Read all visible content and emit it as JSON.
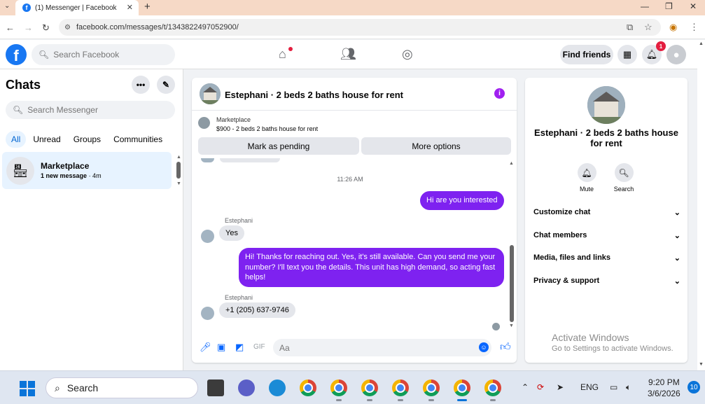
{
  "browser": {
    "tab_title": "(1) Messenger | Facebook",
    "url": "facebook.com/messages/t/1343822497052900/"
  },
  "header": {
    "search_placeholder": "Search Facebook",
    "find_friends_label": "Find friends",
    "notification_count": "1"
  },
  "sidebar": {
    "title": "Chats",
    "search_placeholder": "Search Messenger",
    "filters": [
      "All",
      "Unread",
      "Groups",
      "Communities"
    ],
    "active_filter": "All",
    "chat": {
      "name": "Marketplace",
      "unread_text": "1 new message",
      "time": "· 4m"
    }
  },
  "conversation": {
    "title": "Estephani · 2 beds 2 baths house for rent",
    "marketplace_label": "Marketplace",
    "listing": "$900 - 2 beds 2 baths house for rent",
    "mark_pending_label": "Mark as pending",
    "more_options_label": "More options",
    "timestamp": "11:26 AM",
    "messages": [
      {
        "from": "me",
        "text": "Hi are you interested"
      },
      {
        "from": "Estephani",
        "sender_label": "Estephani",
        "text": "Yes"
      },
      {
        "from": "me",
        "text": "Hi! Thanks for reaching out. Yes, it's still available. Can you send me your number? I'll text you the details. This unit has high demand, so acting fast helps!"
      },
      {
        "from": "Estephani",
        "sender_label": "Estephani",
        "text": "+1 (205) 637-9746"
      }
    ],
    "composer_placeholder": "Aa"
  },
  "details": {
    "name": "Estephani · 2 beds 2 baths house for rent",
    "actions": [
      "Mute",
      "Search"
    ],
    "sections": [
      "Customize chat",
      "Chat members",
      "Media, files and links",
      "Privacy & support"
    ]
  },
  "watermark": {
    "line1": "Activate Windows",
    "line2": "Go to Settings to activate Windows."
  },
  "taskbar": {
    "search_label": "Search",
    "language": "ENG",
    "time": "9:20 PM",
    "date": "3/6/2026",
    "notification_count": "10"
  },
  "colors": {
    "accent": "#1877f2",
    "bubble_out": "#7e22f0",
    "badge": "#e41e3f"
  }
}
